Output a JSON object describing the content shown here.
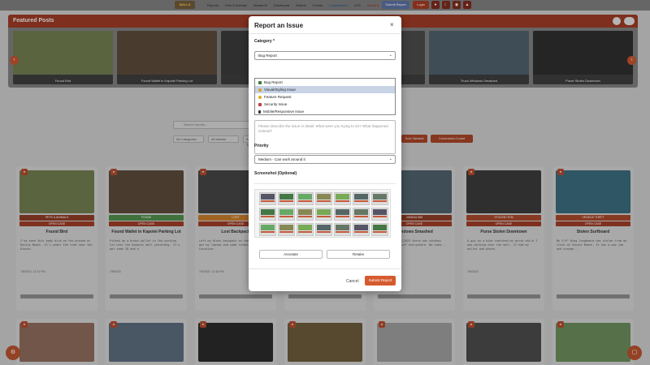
{
  "nav": {
    "logo_text": "WALLS",
    "links": [
      "Reports",
      "Pets & Animals",
      "Wanted ▾",
      "Dashboard",
      "Birders",
      "Events",
      "Leaderboard",
      "LED",
      "Admin ▾"
    ],
    "submit_button": "Submit Report",
    "login_button": "Login"
  },
  "featured": {
    "title": "Featured Posts",
    "cards": [
      {
        "caption": "Found Bird",
        "color": "#6e7b4e"
      },
      {
        "caption": "Found Wallet in Kapolei Parking Lot",
        "color": "#5a4a3a"
      },
      {
        "caption": "",
        "color": "#3a3a3a"
      },
      {
        "caption": "",
        "color": "#4a4a4a"
      },
      {
        "caption": "Truck Windows Smashed",
        "color": "#4e5f6a"
      },
      {
        "caption": "Purse Stolen Downtown",
        "color": "#2e2e2e"
      }
    ]
  },
  "content": {
    "search_placeholder": "Search reports...",
    "filters": [
      "All Categories",
      "All Islands",
      "All Types"
    ],
    "pills": [
      "Sort: Newest",
      "Comments Crowd"
    ],
    "cards": [
      {
        "title": "Found Bird",
        "badge": "PETS & ANIMALS",
        "badge_color": "#8b3b26",
        "color": "#6e7b4e",
        "desc": "I've seen this baby bird on the ground at Kailua Beach. It's under the tree near the Kiosks.",
        "date": "7/8/2023",
        "time": "12:21 PM"
      },
      {
        "title": "Found Wallet in Kapolei Parking Lot",
        "badge": "FOUND",
        "badge_color": "#4f8a4a",
        "color": "#5a4a3a",
        "desc": "Picked up a brown wallet in the parking lot near the Kapolei mall yesterday. It's got some ID and a",
        "date": "7/8/2023",
        "time": ""
      },
      {
        "title": "Lost Backpack",
        "badge": "LOST",
        "badge_color": "#c47a2a",
        "color": "#444",
        "desc": "Left my black backpack on the bus. It's got my laptop and some school books. Location:",
        "date": "7/8/2023",
        "time": "12:18 PM"
      },
      {
        "title": "",
        "badge": "",
        "badge_color": "#8b3b26",
        "color": "#555",
        "desc": "",
        "date": "",
        "time": ""
      },
      {
        "title": "Windows Smashed",
        "badge": "VANDALISM",
        "badge_color": "#8b3b26",
        "color": "#4e5f6a",
        "desc": "Woke up on 1/2/2023 there was windows smashed and stuff everywhere. No idea...",
        "date": "",
        "time": ""
      },
      {
        "title": "Purse Stolen Downtown",
        "badge": "STOLEN ITEM",
        "badge_color": "#a4472a",
        "color": "#3a3a3a",
        "desc": "A guy on a bike snatched my purse while I was walking near the mall. It had my wallet and phone.",
        "date": "7/8/2023",
        "time": ""
      },
      {
        "title": "Stolen Surfboard",
        "badge": "VEHICLE THEFT",
        "badge_color": "#a4472a",
        "color": "#3a6a7a",
        "desc": "My 9'6\" Bing longboard was stolen from my truck at Sunset Beach. It has a wax job and orange...",
        "date": "",
        "time": ""
      }
    ]
  },
  "modal": {
    "title": "Report an Issue",
    "close": "×",
    "category_label": "Category *",
    "category_selected": "Bug Report",
    "category_options": [
      "Bug Report",
      "Visual/Styling Issue",
      "Feature Request",
      "Security Issue",
      "Mobile/Responsive Issue"
    ],
    "description_placeholder": "Please describe the issue in detail. What were you trying to do? What happened instead?",
    "priority_label": "Priority",
    "priority_selected": "Medium - Can work around it",
    "screenshot_label": "Screenshot (Optional)",
    "annotate": "Annotate",
    "retake": "Retake",
    "cancel": "Cancel",
    "submit": "Submit Report"
  },
  "colors": {
    "accent": "#d55a2e",
    "header_red": "#9a3a24",
    "select_highlight": "#c8d4e6"
  }
}
